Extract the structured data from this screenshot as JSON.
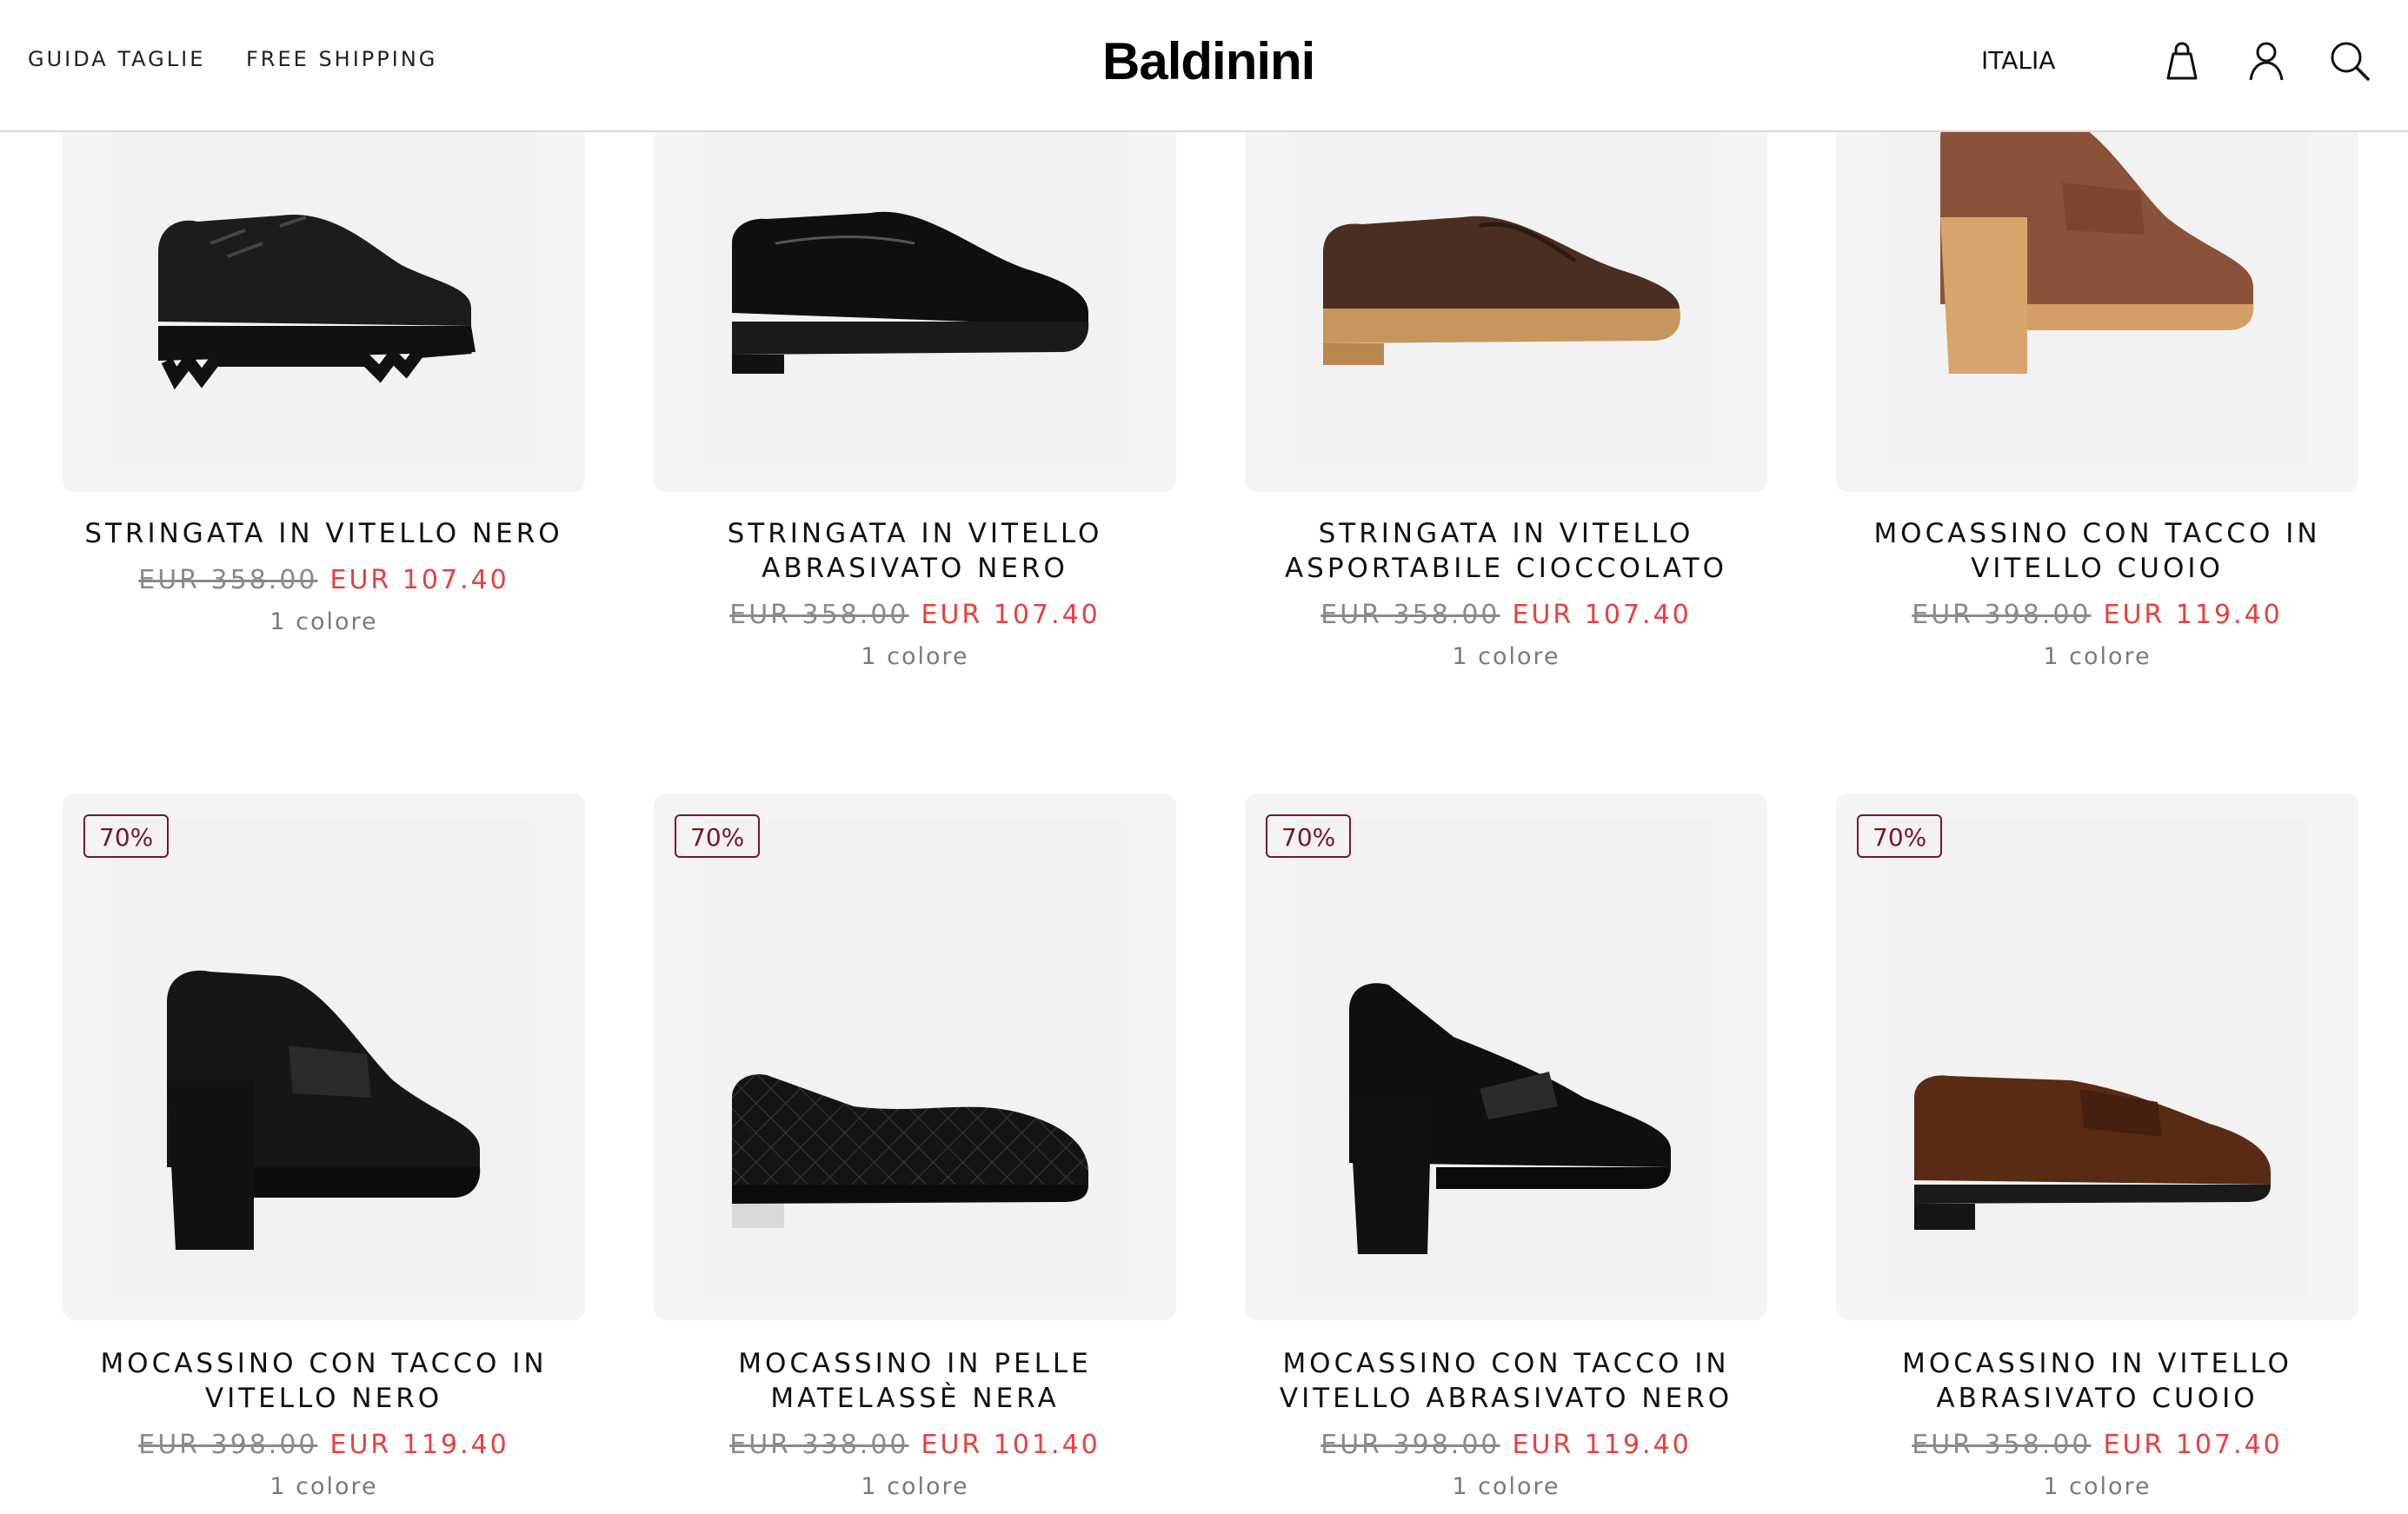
{
  "header": {
    "size_guide": "GUIDA TAGLIE",
    "free_shipping": "FREE SHIPPING",
    "logo": "Baldinini",
    "country": "ITALIA"
  },
  "products": [
    {
      "name": "STRINGATA IN VITELLO NERO",
      "old_price": "EUR 358.00",
      "new_price": "EUR 107.40",
      "colors": "1 colore",
      "badge": ""
    },
    {
      "name": "STRINGATA IN VITELLO ABRASIVATO NERO",
      "old_price": "EUR 358.00",
      "new_price": "EUR 107.40",
      "colors": "1 colore",
      "badge": ""
    },
    {
      "name": "STRINGATA IN VITELLO ASPORTABILE CIOCCOLATO",
      "old_price": "EUR 358.00",
      "new_price": "EUR 107.40",
      "colors": "1 colore",
      "badge": ""
    },
    {
      "name": "MOCASSINO CON TACCO IN VITELLO CUOIO",
      "old_price": "EUR 398.00",
      "new_price": "EUR 119.40",
      "colors": "1 colore",
      "badge": ""
    },
    {
      "name": "MOCASSINO CON TACCO IN VITELLO NERO",
      "old_price": "EUR 398.00",
      "new_price": "EUR 119.40",
      "colors": "1 colore",
      "badge": "70%"
    },
    {
      "name": "MOCASSINO IN PELLE MATELASSÈ NERA",
      "old_price": "EUR 338.00",
      "new_price": "EUR 101.40",
      "colors": "1 colore",
      "badge": "70%"
    },
    {
      "name": "MOCASSINO CON TACCO IN VITELLO ABRASIVATO NERO",
      "old_price": "EUR 398.00",
      "new_price": "EUR 119.40",
      "colors": "1 colore",
      "badge": "70%"
    },
    {
      "name": "MOCASSINO IN VITELLO ABRASIVATO CUOIO",
      "old_price": "EUR 358.00",
      "new_price": "EUR 107.40",
      "colors": "1 colore",
      "badge": "70%"
    }
  ],
  "colors": {
    "sale_price": "#e8403d",
    "old_price": "#8a8a8a",
    "badge": "#7a1425",
    "card_bg": "#f4f4f4"
  }
}
